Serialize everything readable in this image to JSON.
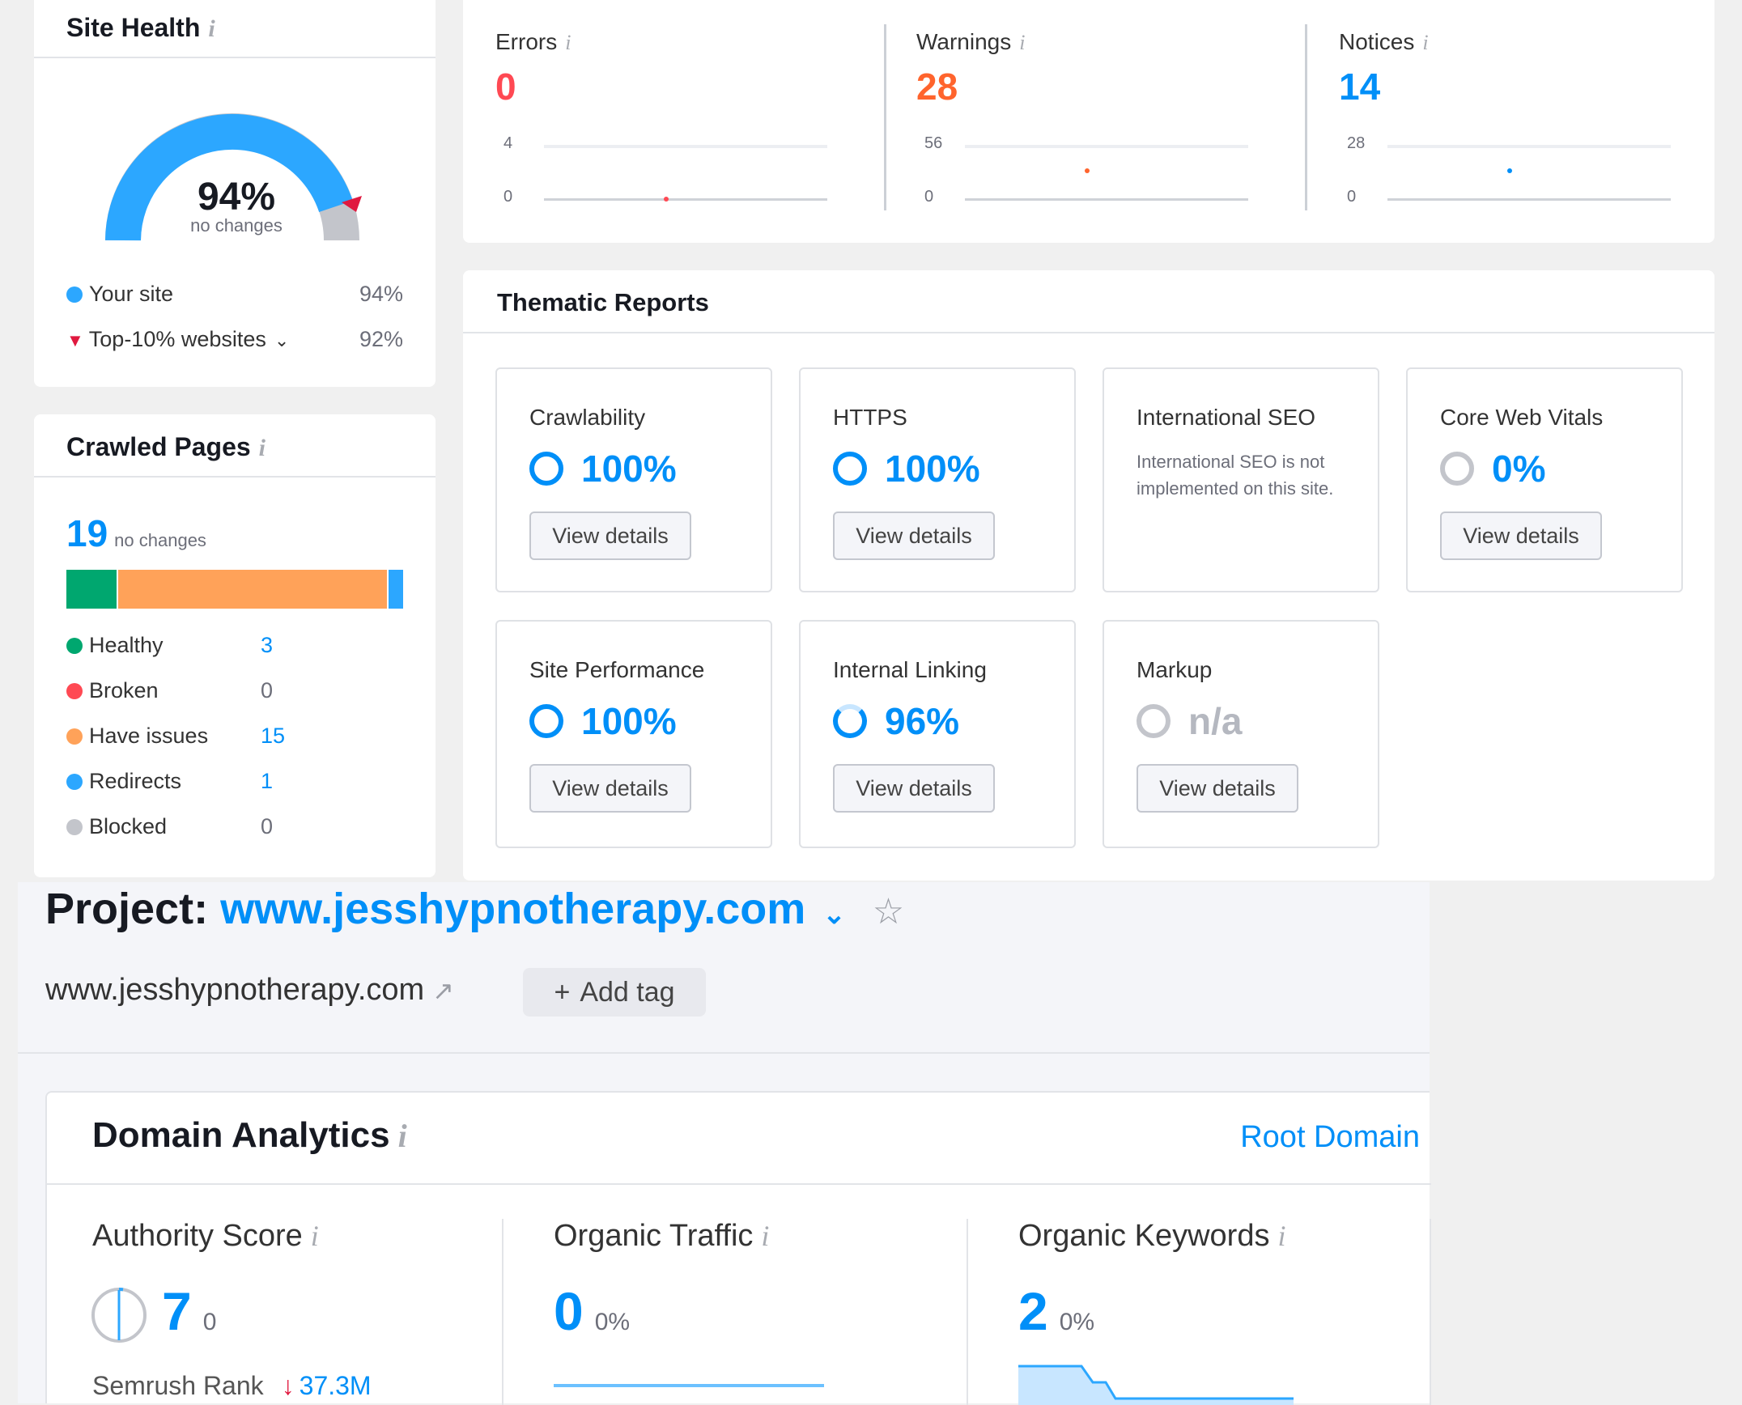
{
  "site_health": {
    "title": "Site Health",
    "percent": "94%",
    "percent_value": 94,
    "change": "no changes",
    "your_site_label": "Your site",
    "your_site_value": "94%",
    "top10_label": "Top-10% websites",
    "top10_value": "92%"
  },
  "issues": [
    {
      "label": "Errors",
      "value": "0",
      "color": "#ff4953",
      "ymax": "4",
      "ymin": "0"
    },
    {
      "label": "Warnings",
      "value": "28",
      "color": "#ff642d",
      "ymax": "56",
      "ymin": "0"
    },
    {
      "label": "Notices",
      "value": "14",
      "color": "#008ff8",
      "ymax": "28",
      "ymin": "0"
    }
  ],
  "crawled_pages": {
    "title": "Crawled Pages",
    "count": "19",
    "change": "no changes",
    "items": [
      {
        "label": "Healthy",
        "value": "3",
        "color": "#00a76f"
      },
      {
        "label": "Broken",
        "value": "0",
        "color": "#ff4953"
      },
      {
        "label": "Have issues",
        "value": "15",
        "color": "#ffa259"
      },
      {
        "label": "Redirects",
        "value": "1",
        "color": "#2ca7ff"
      },
      {
        "label": "Blocked",
        "value": "0",
        "color": "#c3c5cb"
      }
    ]
  },
  "thematic": {
    "title": "Thematic Reports",
    "view_details": "View details",
    "reports": [
      {
        "name": "Crawlability",
        "value": "100%"
      },
      {
        "name": "HTTPS",
        "value": "100%"
      },
      {
        "name": "International SEO",
        "note": "International SEO is not implemented on this site."
      },
      {
        "name": "Core Web Vitals",
        "value": "0%"
      },
      {
        "name": "Site Performance",
        "value": "100%"
      },
      {
        "name": "Internal Linking",
        "value": "96%"
      },
      {
        "name": "Markup",
        "value": "n/a"
      }
    ]
  },
  "project": {
    "prefix": "Project:",
    "domain": "www.jesshypnotherapy.com",
    "url": "www.jesshypnotherapy.com",
    "add_tag": "Add tag"
  },
  "domain_analytics": {
    "title": "Domain Analytics",
    "root_domain": "Root Domain",
    "authority_label": "Authority Score",
    "authority_value": "7",
    "authority_change": "0",
    "semrush_rank_label": "Semrush Rank",
    "semrush_rank_value": "37.3M",
    "traffic_label": "Organic Traffic",
    "traffic_value": "0",
    "traffic_change": "0%",
    "keywords_label": "Organic Keywords",
    "keywords_value": "2",
    "keywords_change": "0%"
  },
  "colors": {
    "accent": "#008ff8",
    "error": "#ff4953",
    "warning": "#ff642d"
  }
}
